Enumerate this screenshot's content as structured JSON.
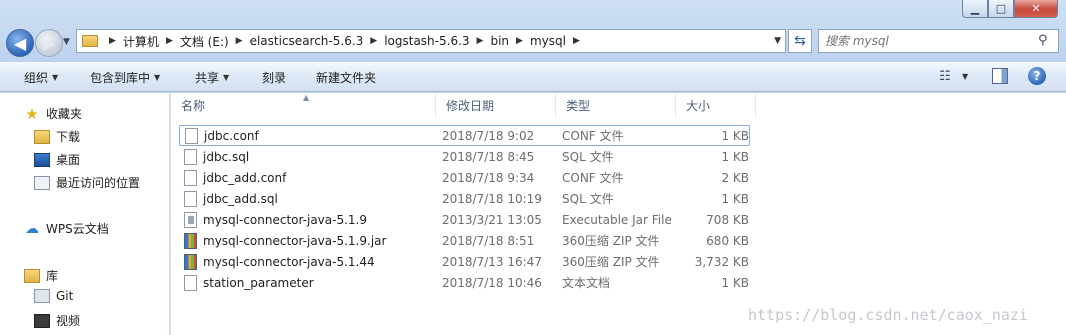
{
  "window": {
    "minimize_glyph": "▁",
    "maximize_glyph": "□",
    "close_glyph": "✕"
  },
  "address": {
    "crumbs": [
      "计算机",
      "文档 (E:)",
      "elasticsearch-5.6.3",
      "logstash-5.6.3",
      "bin",
      "mysql"
    ]
  },
  "search": {
    "placeholder": "搜索 mysql"
  },
  "toolbar": {
    "organize": "组织",
    "include_in_library": "包含到库中",
    "share": "共享",
    "burn": "刻录",
    "new_folder": "新建文件夹"
  },
  "nav": {
    "favorites": "收藏夹",
    "downloads": "下载",
    "desktop": "桌面",
    "recent": "最近访问的位置",
    "wps_cloud": "WPS云文档",
    "library": "库",
    "git": "Git",
    "video": "视频"
  },
  "columns": {
    "name": "名称",
    "date": "修改日期",
    "type": "类型",
    "size": "大小"
  },
  "files": [
    {
      "name": "jdbc.conf",
      "date": "2018/7/18 9:02",
      "type": "CONF 文件",
      "size": "1 KB",
      "icon": "document-icon"
    },
    {
      "name": "jdbc.sql",
      "date": "2018/7/18 8:45",
      "type": "SQL 文件",
      "size": "1 KB",
      "icon": "document-icon"
    },
    {
      "name": "jdbc_add.conf",
      "date": "2018/7/18 9:34",
      "type": "CONF 文件",
      "size": "2 KB",
      "icon": "document-icon"
    },
    {
      "name": "jdbc_add.sql",
      "date": "2018/7/18 10:19",
      "type": "SQL 文件",
      "size": "1 KB",
      "icon": "document-icon"
    },
    {
      "name": "mysql-connector-java-5.1.9",
      "date": "2013/3/21 13:05",
      "type": "Executable Jar File",
      "size": "708 KB",
      "icon": "executable-jar-icon"
    },
    {
      "name": "mysql-connector-java-5.1.9.jar",
      "date": "2018/7/18 8:51",
      "type": "360压缩 ZIP 文件",
      "size": "680 KB",
      "icon": "archive-icon"
    },
    {
      "name": "mysql-connector-java-5.1.44",
      "date": "2018/7/13 16:47",
      "type": "360压缩 ZIP 文件",
      "size": "3,732 KB",
      "icon": "archive-icon"
    },
    {
      "name": "station_parameter",
      "date": "2018/7/18 10:46",
      "type": "文本文档",
      "size": "1 KB",
      "icon": "document-icon"
    }
  ],
  "watermark": "https://blog.csdn.net/caox_nazi"
}
